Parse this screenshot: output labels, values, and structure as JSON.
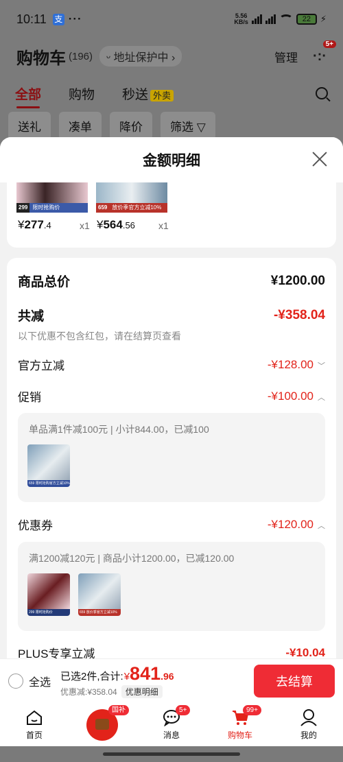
{
  "status_bar": {
    "time": "10:11",
    "network_speed": "5.56",
    "network_unit": "KB/s",
    "battery": "22"
  },
  "header": {
    "title": "购物车",
    "count": "(196)",
    "address_protect": "地址保护中 ›",
    "manage": "管理",
    "more_badge": "5+"
  },
  "tabs": {
    "all": "全部",
    "shopping": "购物",
    "flash": "秒送",
    "takeout": "外卖"
  },
  "filters": [
    "送礼",
    "凑单",
    "降价",
    "筛选 ▽"
  ],
  "sheet": {
    "title": "金额明细",
    "products": [
      {
        "tag": "299",
        "band": "限时抢购价",
        "yen": "¥",
        "price_int": "277",
        "price_dec": ".4",
        "qty": "x1"
      },
      {
        "tag": "659",
        "band": "放价季官方立减10%",
        "yen": "¥",
        "price_int": "564",
        "price_dec": ".56",
        "qty": "x1"
      }
    ],
    "total_label": "商品总价",
    "total_value": "¥1200.00",
    "reduce_label": "共减",
    "reduce_value": "-¥358.04",
    "reduce_note": "以下优惠不包含红包，请在结算页查看",
    "official_label": "官方立减",
    "official_value": "-¥128.00",
    "promo_label": "促销",
    "promo_value": "-¥100.00",
    "promo_detail": "单品满1件减100元 | 小计844.00，已减100",
    "promo_thumb_band": "659 限时抢购官方立减10%",
    "coupon_label": "优惠券",
    "coupon_value": "-¥120.00",
    "coupon_detail": "满1200减120元 | 商品小计1200.00，已减120.00",
    "coupon_thumb_bands": [
      "299 限时抢购价",
      "659 放价季官方立减10%"
    ],
    "plus_label": "PLUS专享立减",
    "plus_value": "-¥10.04"
  },
  "checkout": {
    "select_all": "全选",
    "selected_text": "已选2件,合计:",
    "yen": "¥",
    "amount_int": "841",
    "amount_dec": ".96",
    "discount_text": "优惠减:¥358.04",
    "detail_link": "优惠明细",
    "pay_button": "去结算"
  },
  "nav": {
    "home": "首页",
    "gov_badge": "国补",
    "messages": "消息",
    "messages_badge": "5+",
    "cart": "购物车",
    "cart_badge": "99+",
    "mine": "我的"
  },
  "colors": {
    "accent_red": "#e2231a",
    "pay_button": "#ef2c35",
    "dark_red_tab": "#8b0f12"
  }
}
